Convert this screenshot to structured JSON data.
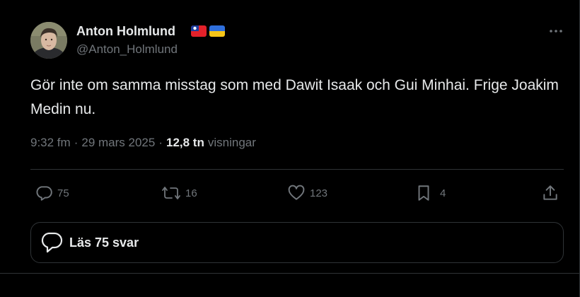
{
  "author": {
    "display_name": "Anton Holmlund",
    "handle": "@Anton_Holmlund",
    "flags": [
      "taiwan-flag",
      "ukraine-flag"
    ]
  },
  "tweet": {
    "text": "Gör inte om samma misstag som med Dawit Isaak och Gui Minhai. Frige Joakim Medin nu.",
    "time": "9:32 fm",
    "date": "29 mars 2025",
    "views_count": "12,8 tn",
    "views_label": "visningar"
  },
  "actions": {
    "replies": "75",
    "retweets": "16",
    "likes": "123",
    "bookmarks": "4"
  },
  "reply_button": {
    "label": "Läs 75 svar"
  },
  "colors": {
    "background": "#000000",
    "text": "#e7e9ea",
    "secondary": "#71767b",
    "border": "#2f3336"
  }
}
